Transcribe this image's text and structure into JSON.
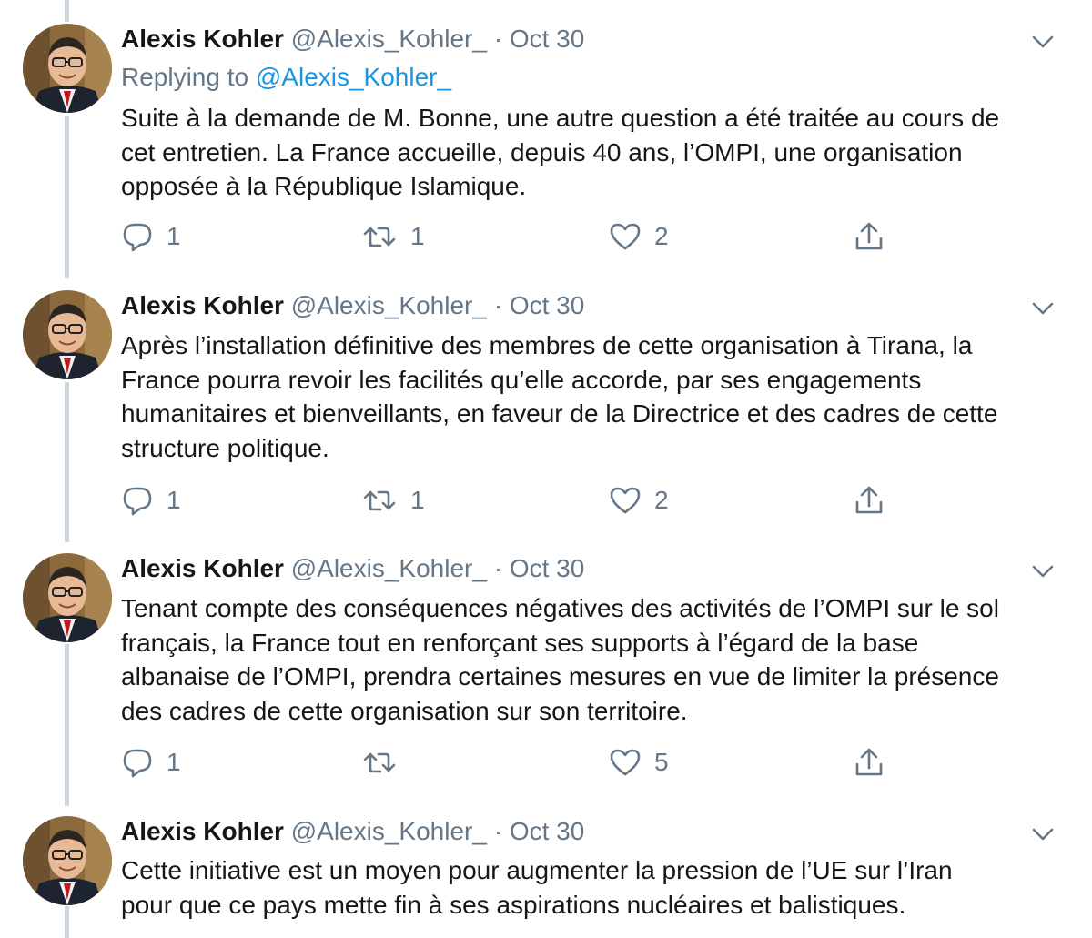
{
  "tweets": [
    {
      "name": "Alexis Kohler",
      "handle": "@Alexis_Kohler_",
      "separator": "·",
      "date": "Oct 30",
      "replying_label": "Replying to",
      "replying_to": "@Alexis_Kohler_",
      "text": "Suite à la demande de M. Bonne, une autre question a été traitée au cours de\ncet entretien. La France accueille, depuis 40 ans, l’OMPI, une organisation\nopposée à la République Islamique.",
      "replies": "1",
      "retweets": "1",
      "likes": "2"
    },
    {
      "name": "Alexis Kohler",
      "handle": "@Alexis_Kohler_",
      "separator": "·",
      "date": "Oct 30",
      "text": "Après l’installation définitive des membres de cette organisation à Tirana, la\nFrance pourra revoir les facilités qu’elle accorde, par ses engagements\nhumanitaires et bienveillants, en faveur de la Directrice et des cadres de cette\nstructure politique.",
      "replies": "1",
      "retweets": "1",
      "likes": "2"
    },
    {
      "name": "Alexis Kohler",
      "handle": "@Alexis_Kohler_",
      "separator": "·",
      "date": "Oct 30",
      "text": "Tenant compte des conséquences négatives des activités de l’OMPI sur le sol\nfrançais, la France tout en renforçant ses supports à l’égard de la base\nalbanaise de l’OMPI, prendra certaines mesures en vue de limiter la présence\ndes cadres de cette organisation sur son territoire.",
      "replies": "1",
      "retweets": "",
      "likes": "5"
    },
    {
      "name": "Alexis Kohler",
      "handle": "@Alexis_Kohler_",
      "separator": "·",
      "date": "Oct 30",
      "text": "Cette initiative est un moyen pour augmenter la pression de l’UE sur l’Iran\npour que ce pays mette fin à ses aspirations nucléaires et balistiques."
    }
  ],
  "colors": {
    "text": "#14171a",
    "secondary": "#657786",
    "link": "#1b95e0",
    "thread": "#ccd6dd"
  },
  "icons": [
    "reply-icon",
    "retweet-icon",
    "like-icon",
    "share-icon",
    "chevron-down-icon"
  ]
}
